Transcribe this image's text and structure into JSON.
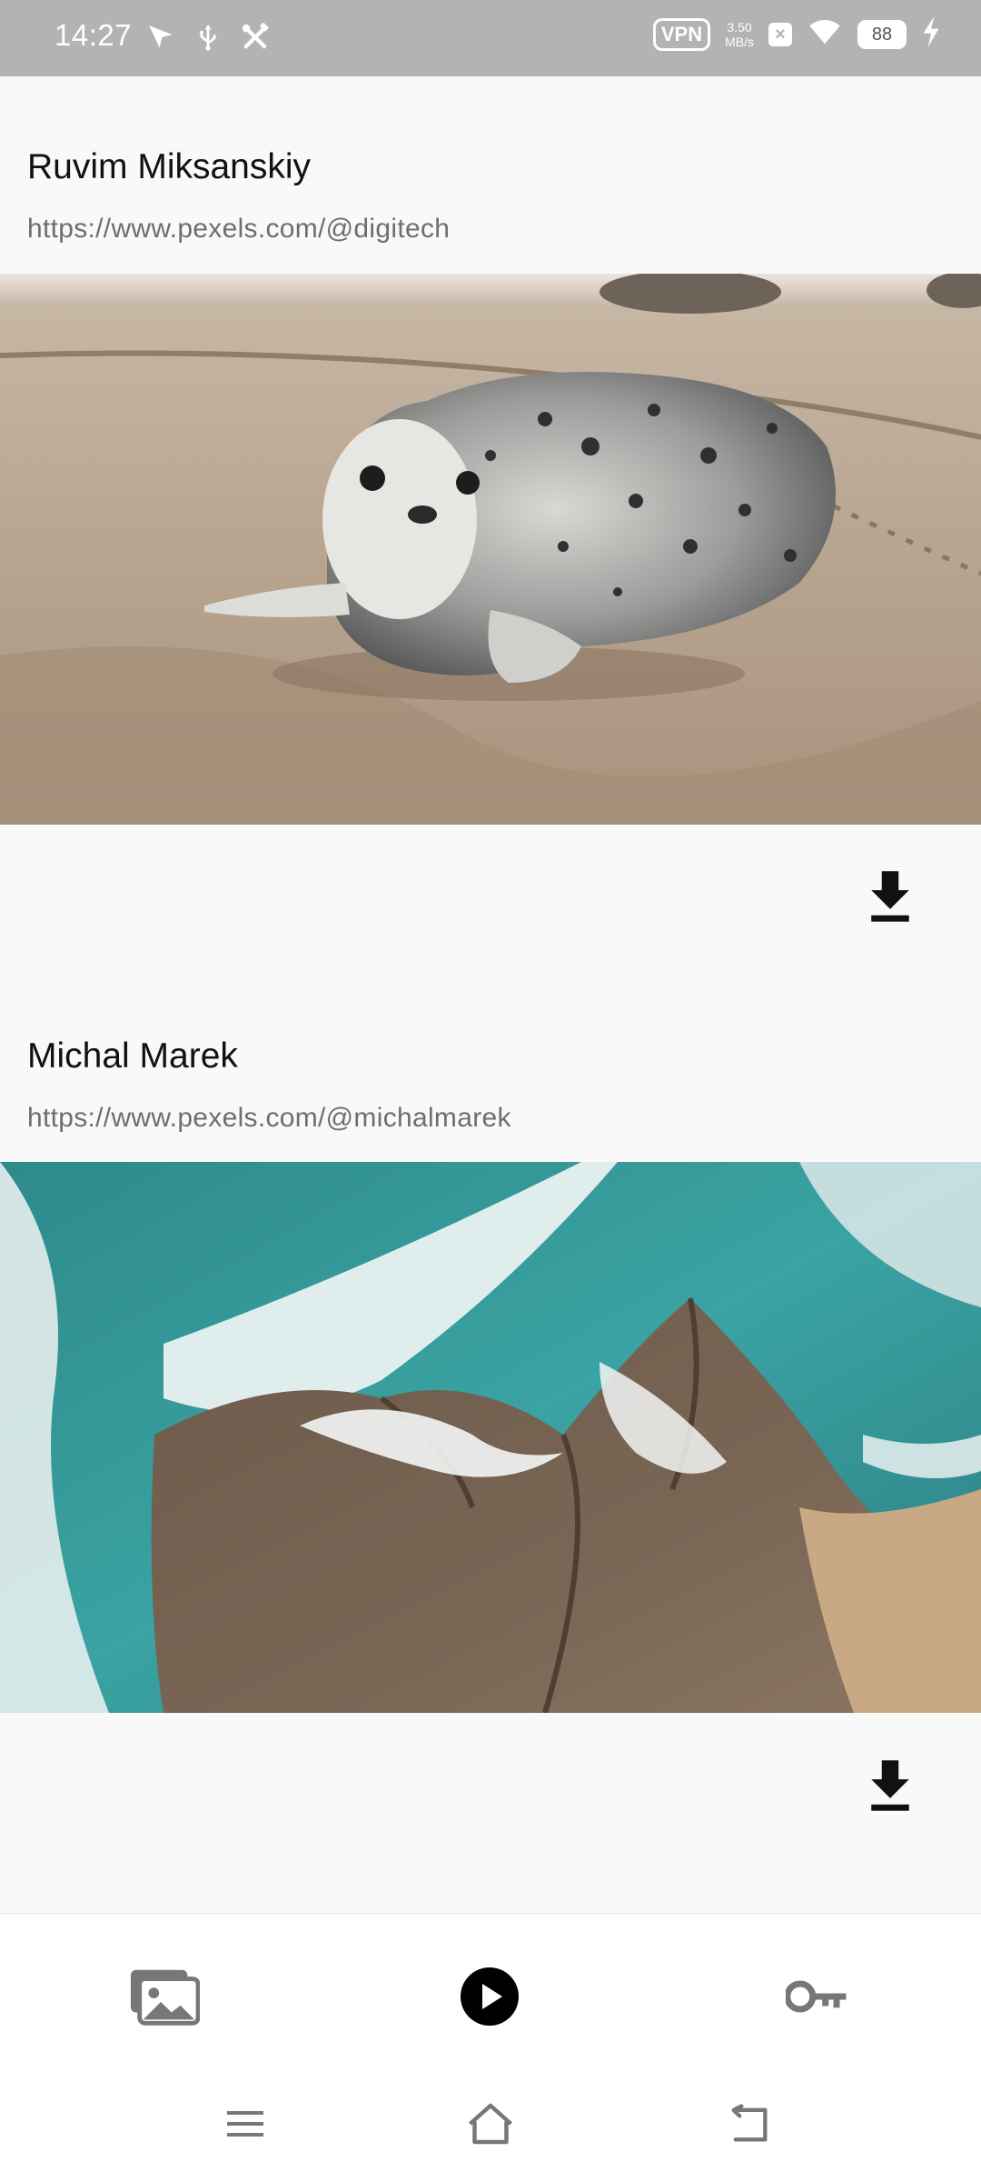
{
  "status_bar": {
    "time": "14:27",
    "vpn": "VPN",
    "net_speed_value": "3.50",
    "net_speed_unit": "MB/s",
    "battery": "88",
    "icons": [
      "location-arrow-icon",
      "usb-icon",
      "tools-icon",
      "vpn-icon",
      "close-box-icon",
      "wifi-icon",
      "battery-icon",
      "charging-bolt-icon"
    ]
  },
  "feed": {
    "items": [
      {
        "author": "Ruvim Miksanskiy",
        "url": "https://www.pexels.com/@digitech",
        "image_subject": "seal-on-beach"
      },
      {
        "author": "Michal Marek",
        "url": "https://www.pexels.com/@michalmarek",
        "image_subject": "aerial-ocean-waves-rocks"
      }
    ]
  },
  "bottom_nav": {
    "tabs": [
      {
        "icon": "photos-icon",
        "selected": false
      },
      {
        "icon": "play-circle-icon",
        "selected": true
      },
      {
        "icon": "key-icon",
        "selected": false
      }
    ]
  },
  "system_nav": {
    "buttons": [
      "menu-icon",
      "home-icon",
      "back-icon"
    ]
  },
  "colors": {
    "status_bar_bg": "#b3b3b3",
    "page_bg": "#f9f9f9",
    "primary_text": "#111111",
    "secondary_text": "#6e6e6e",
    "nav_inactive": "#666666",
    "nav_active": "#000000"
  }
}
